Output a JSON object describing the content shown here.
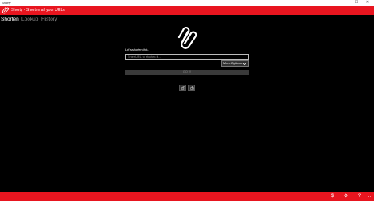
{
  "window": {
    "title": "Shorty",
    "minimize_glyph": "—",
    "maximize_glyph": "☐",
    "close_glyph": "✕"
  },
  "app": {
    "title": "Shorty - Shorten all your URLs",
    "accent_color": "#e8151f",
    "logo_icon": "paperclip-icon"
  },
  "tabs": [
    {
      "label": "Shorten",
      "active": true
    },
    {
      "label": "Lookup",
      "active": false
    },
    {
      "label": "History",
      "active": false
    }
  ],
  "main": {
    "logo_icon": "link-icon",
    "prompt": "Let's shorten this.",
    "url_input": {
      "value": "",
      "placeholder": "Enter URL to shorten it..."
    },
    "more_options_label": "More Options",
    "go_label": "GO !!!",
    "actions": [
      {
        "icon": "copy-icon"
      },
      {
        "icon": "share-icon"
      }
    ]
  },
  "bottom_bar": {
    "icons": [
      {
        "icon": "dollar-icon",
        "glyph": "$"
      },
      {
        "icon": "gear-icon",
        "glyph": "⚙"
      },
      {
        "icon": "help-icon",
        "glyph": "?"
      },
      {
        "icon": "more-icon",
        "glyph": "…"
      }
    ]
  }
}
